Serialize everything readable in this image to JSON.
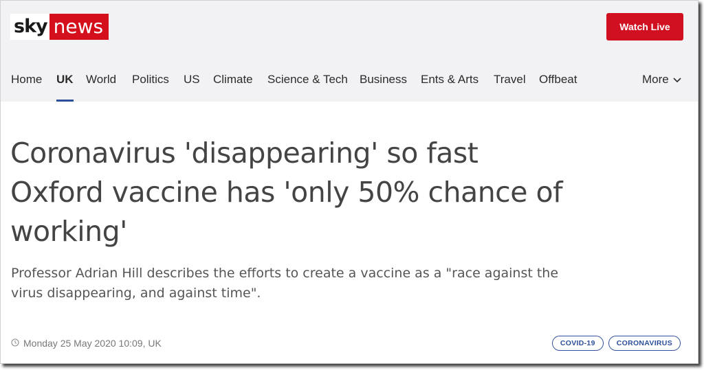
{
  "header": {
    "logo_sky": "sky",
    "logo_news": "news",
    "watch_live_label": "Watch Live",
    "brand_color": "#d3101c",
    "accent_color": "#2d4f9a"
  },
  "nav": {
    "items": [
      {
        "label": "Home",
        "active": false
      },
      {
        "label": "UK",
        "active": true
      },
      {
        "label": "World",
        "active": false
      },
      {
        "label": "Politics",
        "active": false
      },
      {
        "label": "US",
        "active": false
      },
      {
        "label": "Climate",
        "active": false
      },
      {
        "label": "Science & Tech",
        "active": false
      },
      {
        "label": "Business",
        "active": false
      },
      {
        "label": "Ents & Arts",
        "active": false
      },
      {
        "label": "Travel",
        "active": false
      },
      {
        "label": "Offbeat",
        "active": false
      }
    ],
    "more_label": "More",
    "more_icon": "chevron-down-icon"
  },
  "article": {
    "headline": "Coronavirus 'disappearing' so fast Oxford vaccine has 'only 50% chance of working'",
    "standfirst": "Professor Adrian Hill describes the efforts to create a vaccine as a \"race against the virus disappearing, and against time\".",
    "timestamp": "Monday 25 May 2020 10:09, UK",
    "timestamp_icon": "clock-icon",
    "tags": [
      {
        "label": "COVID-19"
      },
      {
        "label": "CORONAVIRUS"
      }
    ]
  }
}
